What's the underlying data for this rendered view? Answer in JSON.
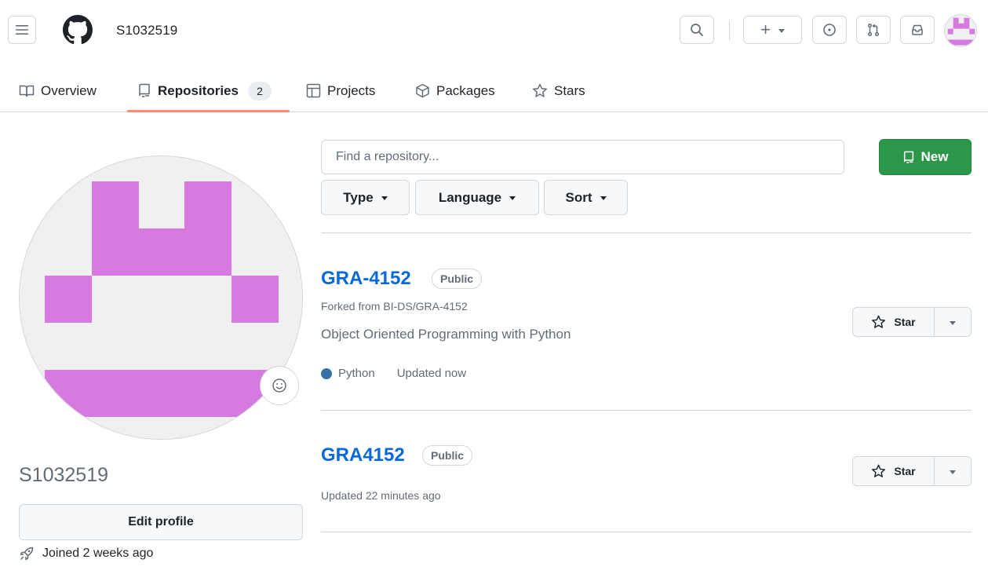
{
  "header": {
    "username": "S1032519",
    "create_symbol": "+"
  },
  "tabs": [
    {
      "label": "Overview",
      "icon": "book-icon"
    },
    {
      "label": "Repositories",
      "icon": "repo-icon",
      "count": "2",
      "active": true
    },
    {
      "label": "Projects",
      "icon": "table-icon"
    },
    {
      "label": "Packages",
      "icon": "package-icon"
    },
    {
      "label": "Stars",
      "icon": "star-icon"
    }
  ],
  "profile": {
    "name": "S1032519",
    "edit_label": "Edit profile",
    "joined": "Joined 2 weeks ago",
    "avatar_color": "#d67ae0"
  },
  "repo_list": {
    "search_placeholder": "Find a repository...",
    "new_label": "New",
    "filters": {
      "type": "Type",
      "language": "Language",
      "sort": "Sort"
    },
    "repos": [
      {
        "name": "GRA-4152",
        "visibility": "Public",
        "fork_text": "Forked from BI-DS/GRA-4152",
        "description": "Object Oriented Programming with Python",
        "language": "Python",
        "language_color": "#3572a5",
        "updated": "Updated now",
        "star_label": "Star"
      },
      {
        "name": "GRA4152",
        "visibility": "Public",
        "updated": "Updated 22 minutes ago",
        "star_label": "Star"
      }
    ]
  },
  "colors": {
    "accent_green": "#2c974b",
    "link_blue": "#0969da",
    "tab_underline": "#fd8c73"
  }
}
